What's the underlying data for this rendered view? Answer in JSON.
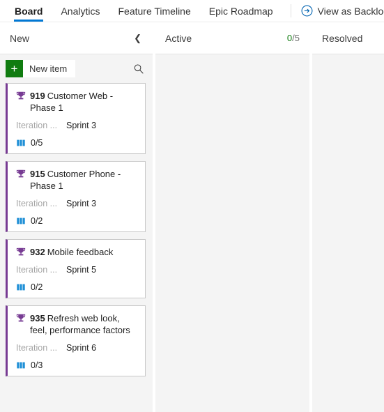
{
  "header": {
    "tabs": [
      {
        "label": "Board",
        "active": true
      },
      {
        "label": "Analytics",
        "active": false
      },
      {
        "label": "Feature Timeline",
        "active": false
      },
      {
        "label": "Epic Roadmap",
        "active": false
      }
    ],
    "backlog_link": {
      "label": "View as Backlog",
      "icon": "arrow-circle-right-icon"
    },
    "accent_color": "#0078d4"
  },
  "toolbar": {
    "new_item_label": "New item",
    "new_item_icon": "plus-icon",
    "new_item_color": "#107c10",
    "search_icon": "search-icon"
  },
  "board": {
    "columns": [
      {
        "name": "New",
        "collapse_icon": "chevron-left-icon",
        "count": null,
        "limit": null,
        "has_toolbar": true
      },
      {
        "name": "Active",
        "collapse_icon": null,
        "count": "0",
        "limit": "/5",
        "has_toolbar": false
      },
      {
        "name": "Resolved",
        "collapse_icon": null,
        "count": null,
        "limit": null,
        "has_toolbar": false
      }
    ],
    "card_accent_color": "#773b93",
    "cards": [
      {
        "id": "919",
        "title": "Customer Web - Phase 1",
        "type_icon": "trophy-icon",
        "meta_label": "Iteration ...",
        "meta_value": "Sprint 3",
        "child_icon": "story-book-icon",
        "child_count": "0/5"
      },
      {
        "id": "915",
        "title": "Customer Phone - Phase 1",
        "type_icon": "trophy-icon",
        "meta_label": "Iteration ...",
        "meta_value": "Sprint 3",
        "child_icon": "story-book-icon",
        "child_count": "0/2"
      },
      {
        "id": "932",
        "title": "Mobile feedback",
        "type_icon": "trophy-icon",
        "meta_label": "Iteration ...",
        "meta_value": "Sprint 5",
        "child_icon": "story-book-icon",
        "child_count": "0/2"
      },
      {
        "id": "935",
        "title": "Refresh web look, feel, performance factors",
        "type_icon": "trophy-icon",
        "meta_label": "Iteration ...",
        "meta_value": "Sprint 6",
        "child_icon": "story-book-icon",
        "child_count": "0/3"
      }
    ]
  }
}
